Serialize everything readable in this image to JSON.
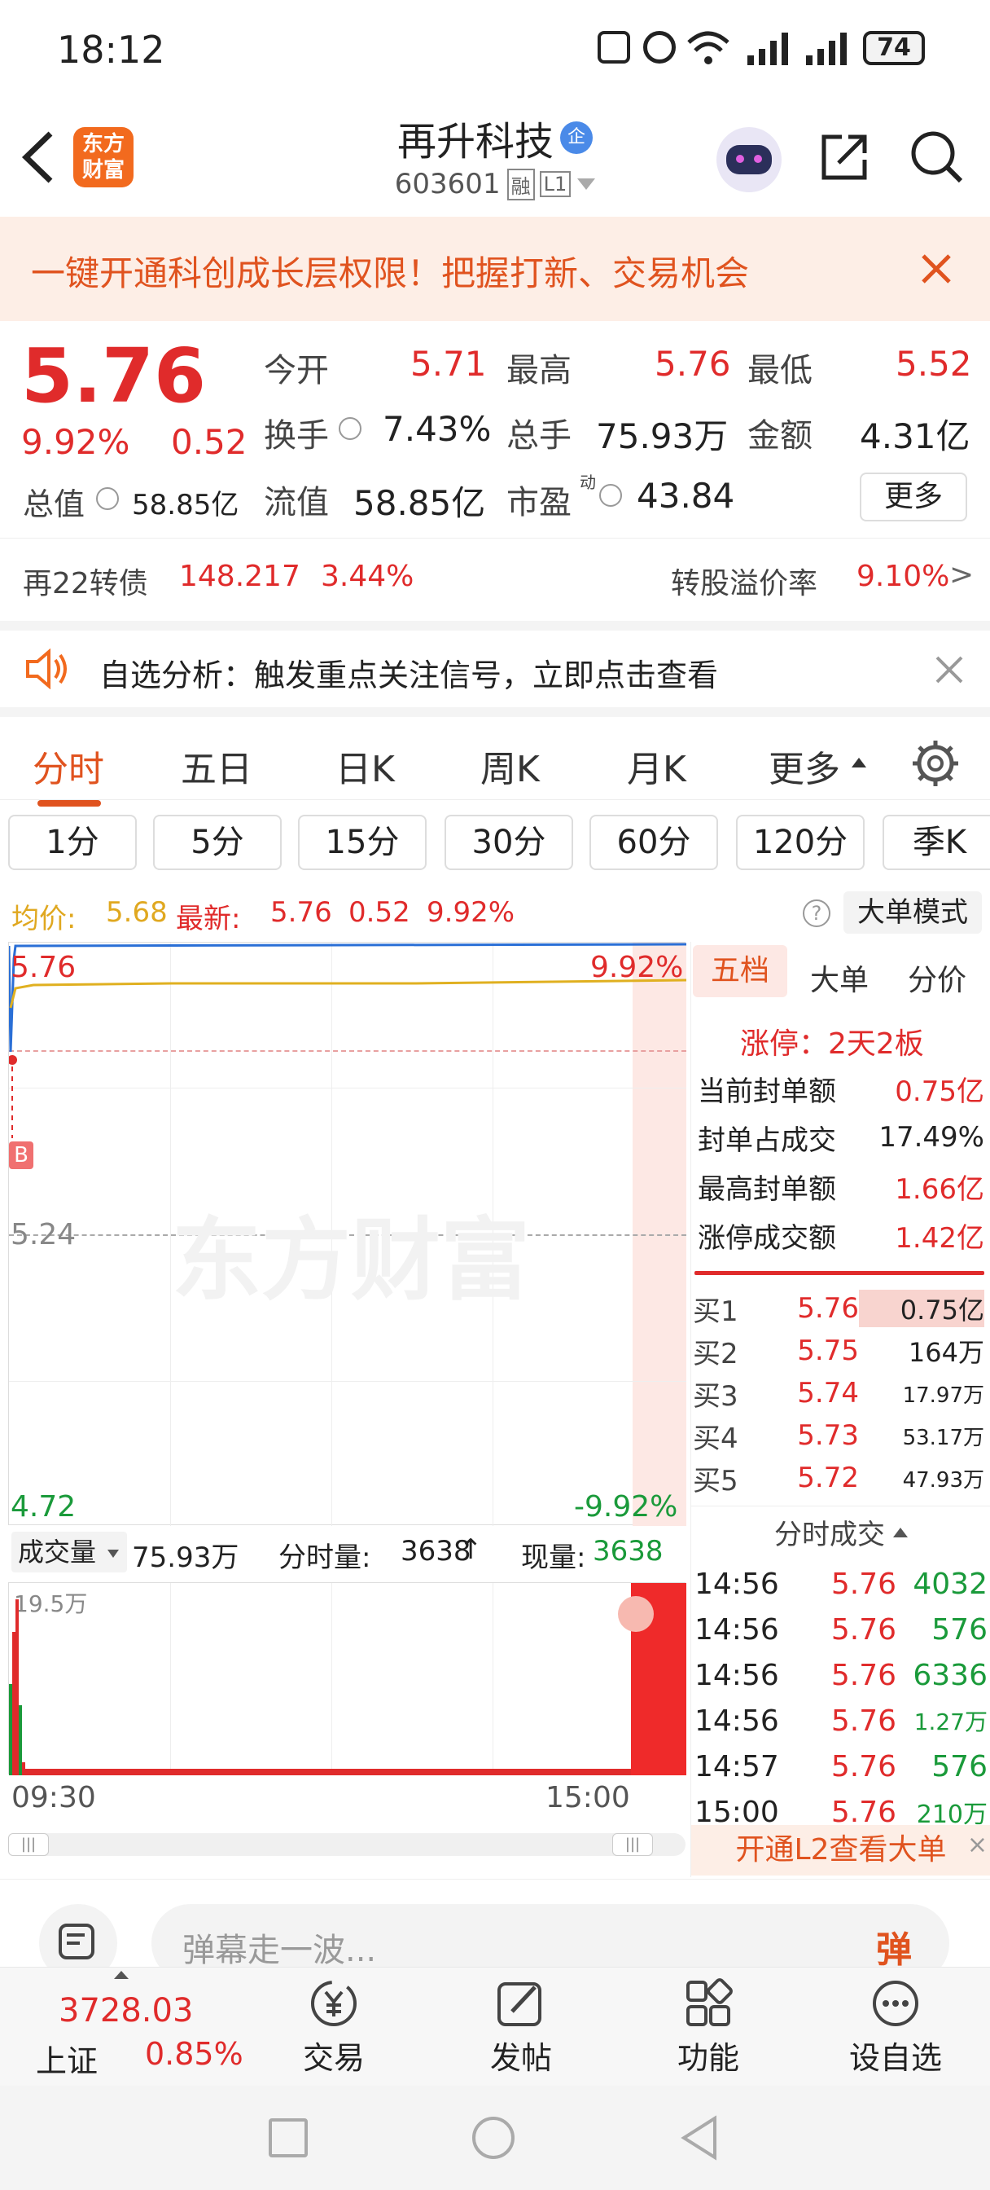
{
  "status_bar": {
    "time": "18:12",
    "battery": "74"
  },
  "header": {
    "logo_text": "东方财富",
    "stock_name": "再升科技",
    "badge": "企",
    "stock_code": "603601",
    "tag_rong": "融",
    "tag_level": "L1"
  },
  "banner": {
    "text": "一键开通科创成长层权限！把握打新、交易机会"
  },
  "quote": {
    "price": "5.76",
    "change_pct": "9.92%",
    "change": "0.52",
    "open_label": "今开",
    "open": "5.71",
    "high_label": "最高",
    "high": "5.76",
    "low_label": "最低",
    "low": "5.52",
    "turnover_label": "换手",
    "turnover": "7.43%",
    "volume_label": "总手",
    "volume": "75.93万",
    "amount_label": "金额",
    "amount": "4.31亿",
    "mcap_label": "总值",
    "mcap": "58.85亿",
    "float_label": "流值",
    "float_cap": "58.85亿",
    "pe_label": "市盈",
    "pe_sup": "动",
    "pe": "43.84",
    "more_label": "更多"
  },
  "bond": {
    "name": "再22转债",
    "price": "148.217",
    "pct": "3.44%",
    "premium_label": "转股溢价率",
    "premium": "9.10%"
  },
  "notice": {
    "text": "自选分析：触发重点关注信号，立即点击查看"
  },
  "chart_tabs": [
    "分时",
    "五日",
    "日K",
    "周K",
    "月K",
    "更多"
  ],
  "period_tabs": [
    "1分",
    "5分",
    "15分",
    "30分",
    "60分",
    "120分",
    "季K"
  ],
  "info_line": {
    "avg_label": "均价:",
    "avg": "5.68",
    "latest_label": "最新:",
    "latest": "5.76",
    "change": "0.52",
    "pct": "9.92%",
    "big_order_mode": "大单模式"
  },
  "chart": {
    "top_price": "5.76",
    "top_pct": "9.92%",
    "mid_price": "5.24",
    "bottom_price": "4.72",
    "bottom_pct": "-9.92%",
    "marker": "B",
    "watermark": "东方财富",
    "vol_label": "成交量",
    "vol_total": "75.93万",
    "vol_min_label": "分时量:",
    "vol_min": "3638",
    "vol_now_label": "现量:",
    "vol_now": "3638",
    "vol_max": "19.5万",
    "time_start": "09:30",
    "time_end": "15:00",
    "line_color": "#2a6fd6",
    "avg_color": "#e0b020",
    "limit_color": "#e02b2b"
  },
  "right_panel": {
    "tabs": [
      "五档",
      "大单",
      "分价"
    ],
    "limit_up": "涨停：2天2板",
    "stats": [
      {
        "label": "当前封单额",
        "value": "0.75亿"
      },
      {
        "label": "封单占成交",
        "value": "17.49%"
      },
      {
        "label": "最高封单额",
        "value": "1.66亿"
      },
      {
        "label": "涨停成交额",
        "value": "1.42亿"
      }
    ],
    "bids": [
      {
        "label": "买1",
        "price": "5.76",
        "vol": "0.75亿"
      },
      {
        "label": "买2",
        "price": "5.75",
        "vol": "164万"
      },
      {
        "label": "买3",
        "price": "5.74",
        "vol": "17.97万"
      },
      {
        "label": "买4",
        "price": "5.73",
        "vol": "53.17万"
      },
      {
        "label": "买5",
        "price": "5.72",
        "vol": "47.93万"
      }
    ],
    "ticks_title": "分时成交",
    "ticks": [
      {
        "time": "14:56",
        "price": "5.76",
        "vol": "4032"
      },
      {
        "time": "14:56",
        "price": "5.76",
        "vol": "576"
      },
      {
        "time": "14:56",
        "price": "5.76",
        "vol": "6336"
      },
      {
        "time": "14:56",
        "price": "5.76",
        "vol": "1.27万"
      },
      {
        "time": "14:57",
        "price": "5.76",
        "vol": "576"
      },
      {
        "time": "15:00",
        "price": "5.76",
        "vol": "210万"
      }
    ],
    "l2_promo": "开通L2查看大单"
  },
  "comment": {
    "placeholder": "弹幕走一波...",
    "danmu_label": "弹"
  },
  "bottom_nav": {
    "index_value": "3728.03",
    "index_name": "上证",
    "index_pct": "0.85%",
    "items": [
      "交易",
      "发帖",
      "功能",
      "设自选"
    ]
  }
}
